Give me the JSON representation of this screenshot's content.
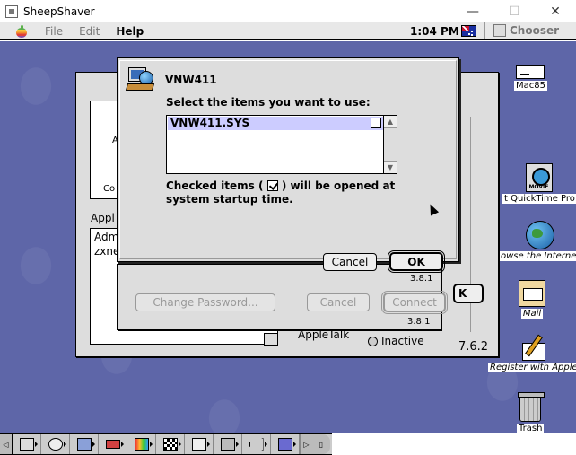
{
  "host_window": {
    "title": "SheepShaver",
    "min": "—",
    "max": "☐",
    "close": "✕"
  },
  "menubar": {
    "items": [
      {
        "label": "File",
        "active": false
      },
      {
        "label": "Edit",
        "active": false
      },
      {
        "label": "Help",
        "active": true
      }
    ],
    "clock": "1:04 PM",
    "chooser": "Chooser"
  },
  "dialog": {
    "title": "VNW411",
    "prompt": "Select the items you want to use:",
    "items": [
      {
        "name": "VNW411.SYS",
        "checked": false
      }
    ],
    "note_before": "Checked items (",
    "note_after": ") will be opened at system startup time.",
    "cancel": "Cancel",
    "ok": "OK",
    "version": "3.8.1"
  },
  "password_dialog": {
    "change_password": "Change Password...",
    "cancel": "Cancel",
    "connect": "Connect",
    "version": "3.8.1"
  },
  "back_window": {
    "panel_text_a": "A",
    "panel_text_b": "Co",
    "applet_label": "Appl",
    "list_items": [
      "Adm",
      "zxne"
    ],
    "ok_partial": "K",
    "appletalk": "AppleTalk",
    "inactive": "Inactive",
    "version": "7.6.2"
  },
  "desktop_icons": [
    {
      "label": "Mac85"
    },
    {
      "label": "t QuickTime Pro"
    },
    {
      "label": "owse the Internet"
    },
    {
      "label": "Mail"
    },
    {
      "label": "Register with Apple"
    },
    {
      "label": "Trash"
    }
  ]
}
